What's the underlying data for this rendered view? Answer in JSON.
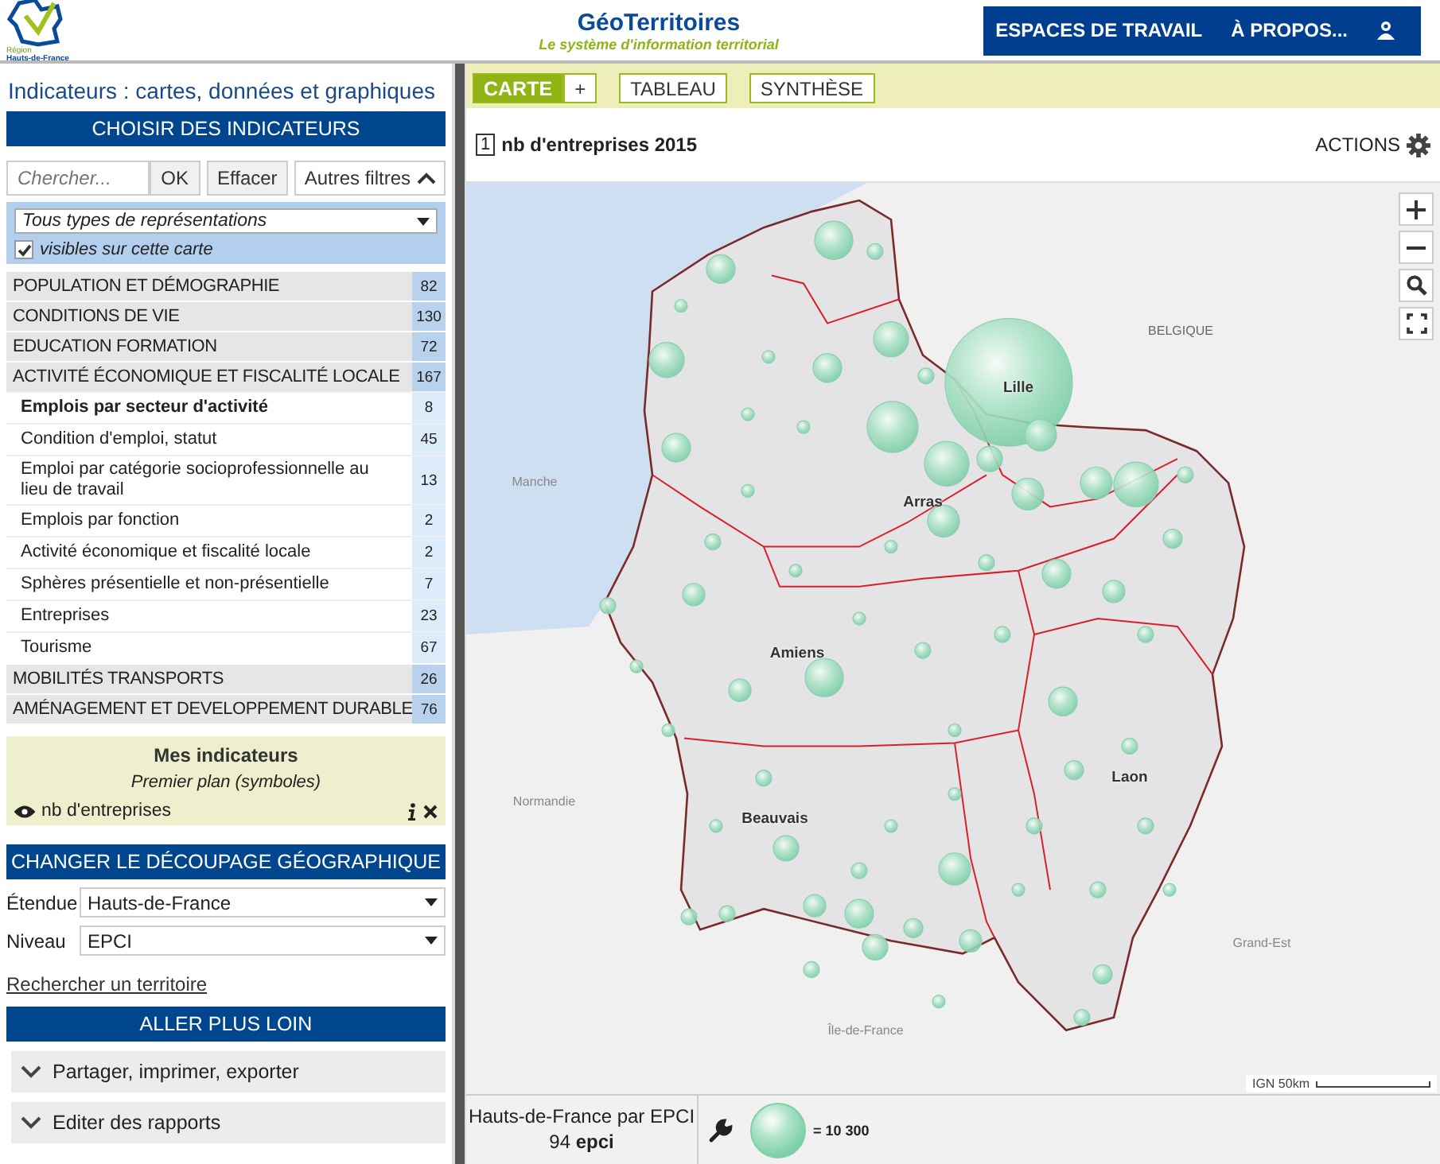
{
  "header": {
    "logo_small": "Région",
    "logo_name": "Hauts-de-France",
    "title": "GéoTerritoires",
    "subtitle": "Le système d'information territorial",
    "nav": [
      "ESPACES DE TRAVAIL",
      "À PROPOS..."
    ]
  },
  "sidebar": {
    "heading": "Indicateurs : cartes, données et graphiques",
    "choose_header": "CHOISIR DES INDICATEURS",
    "search": {
      "placeholder": "Chercher...",
      "ok": "OK",
      "clear": "Effacer",
      "filters": "Autres filtres",
      "filters_expanded": true
    },
    "representation": "Tous types de représentations",
    "visible_only": {
      "label": "visibles sur cette carte",
      "checked": true
    },
    "themes": [
      {
        "label": "POPULATION ET DÉMOGRAPHIE",
        "count": "82"
      },
      {
        "label": "CONDITIONS DE VIE",
        "count": "130"
      },
      {
        "label": "EDUCATION FORMATION",
        "count": "72"
      },
      {
        "label": "ACTIVITÉ ÉCONOMIQUE ET FISCALITÉ LOCALE",
        "count": "167",
        "children": [
          {
            "label": "Emplois par secteur d'activité",
            "count": "8",
            "selected": true
          },
          {
            "label": "Condition d'emploi, statut",
            "count": "45",
            "selected": false
          },
          {
            "label": "Emploi par catégorie socioprofessionnelle au lieu de travail",
            "count": "13",
            "selected": false
          },
          {
            "label": "Emplois par fonction",
            "count": "2",
            "selected": false
          },
          {
            "label": "Activité économique et fiscalité locale",
            "count": "2",
            "selected": false
          },
          {
            "label": "Sphères présentielle et non-présentielle",
            "count": "7",
            "selected": false
          },
          {
            "label": "Entreprises",
            "count": "23",
            "selected": false
          },
          {
            "label": "Tourisme",
            "count": "67",
            "selected": false
          }
        ]
      },
      {
        "label": "MOBILITÉS TRANSPORTS",
        "count": "26"
      },
      {
        "label": "AMÉNAGEMENT ET DEVELOPPEMENT DURABLE",
        "count": "76"
      }
    ],
    "my_indicators": {
      "title": "Mes indicateurs",
      "layer": "Premier plan (symboles)",
      "items": [
        {
          "label": "nb d'entreprises",
          "visible": true
        }
      ]
    },
    "geo_header": "CHANGER LE DÉCOUPAGE GÉOGRAPHIQUE",
    "extent": {
      "label": "Étendue",
      "value": "Hauts-de-France"
    },
    "level": {
      "label": "Niveau",
      "value": "EPCI"
    },
    "search_territory": "Rechercher un territoire",
    "more_header": "ALLER PLUS LOIN",
    "accordions": [
      {
        "label": "Partager, imprimer, exporter",
        "expanded": false
      },
      {
        "label": "Editer des rapports",
        "expanded": false
      }
    ]
  },
  "tabs": [
    {
      "label": "CARTE",
      "selected": true
    },
    {
      "label": "+",
      "selected": false
    },
    {
      "label": "TABLEAU",
      "selected": false
    },
    {
      "label": "SYNTHÈSE",
      "selected": false
    }
  ],
  "map_title": {
    "number": "1",
    "text": "nb d'entreprises 2015",
    "actions": "ACTIONS"
  },
  "map": {
    "labels": [
      "Lille",
      "Arras",
      "Amiens",
      "Laon",
      "Beauvais",
      "BELGIQUE",
      "Manche",
      "Normandie",
      "Grand-Est",
      "Île-de-France"
    ],
    "scale": "IGN  50km"
  },
  "legend": {
    "territory": "Hauts-de-France par EPCI",
    "count": "94 **epci**",
    "symbol_value": "= 10 300"
  }
}
